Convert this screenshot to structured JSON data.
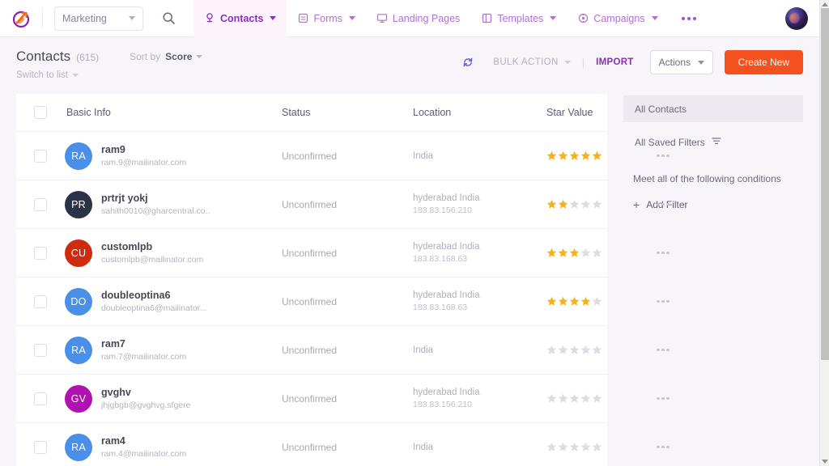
{
  "topnav": {
    "logo_name": "logo-icon",
    "workspace": {
      "label": "Marketing",
      "icon": "chevron-down-icon"
    },
    "search_icon": "search-icon",
    "items": [
      {
        "label": "Contacts",
        "icon": "person-icon",
        "active": true,
        "has_chevron": true
      },
      {
        "label": "Forms",
        "icon": "form-icon",
        "active": false,
        "has_chevron": true
      },
      {
        "label": "Landing Pages",
        "icon": "monitor-icon",
        "active": false,
        "has_chevron": false
      },
      {
        "label": "Templates",
        "icon": "template-icon",
        "active": false,
        "has_chevron": true
      },
      {
        "label": "Campaigns",
        "icon": "target-icon",
        "active": false,
        "has_chevron": true
      }
    ],
    "overflow_icon": "more-horizontal-icon",
    "avatar_name": "user-avatar"
  },
  "header": {
    "title": "Contacts",
    "count": "(615)",
    "switch_to_list": "Switch to list",
    "sort_label": "Sort by",
    "sort_value": "Score",
    "refresh_icon": "refresh-icon",
    "bulk_action": "BULK ACTION",
    "divider": "|",
    "import": "IMPORT",
    "actions": "Actions",
    "create_new": "Create New",
    "create_color": "#f4511e",
    "import_color": "#8b2fb5"
  },
  "table": {
    "columns": [
      "Basic Info",
      "Status",
      "Location",
      "Star Value"
    ],
    "rows": [
      {
        "initials": "RA",
        "avatar_color": "#4a90e8",
        "name": "ram9",
        "email": "ram.9@mailinator.com",
        "status": "Unconfirmed",
        "city": "India",
        "ip": "",
        "stars": 5
      },
      {
        "initials": "PR",
        "avatar_color": "#2b3346",
        "name": "prtrjt yokj",
        "email": "sahith0010@gharcentral.co..",
        "status": "Unconfirmed",
        "city": "hyderabad India",
        "ip": "183.83.156.210",
        "stars": 2
      },
      {
        "initials": "CU",
        "avatar_color": "#d02b10",
        "name": "customlpb",
        "email": "customlpb@mailinator.com",
        "status": "Unconfirmed",
        "city": "hyderabad India",
        "ip": "183.83.168.63",
        "stars": 3
      },
      {
        "initials": "DO",
        "avatar_color": "#4a90e8",
        "name": "doubleoptina6",
        "email": "doubleoptina6@mailinator...",
        "status": "Unconfirmed",
        "city": "hyderabad India",
        "ip": "183.83.168.63",
        "stars": 4
      },
      {
        "initials": "RA",
        "avatar_color": "#4a90e8",
        "name": "ram7",
        "email": "ram.7@mailinator.com",
        "status": "Unconfirmed",
        "city": "India",
        "ip": "",
        "stars": 0
      },
      {
        "initials": "GV",
        "avatar_color": "#b011b0",
        "name": "gvghv",
        "email": "jhjgbgb@gvghvg.sfgere",
        "status": "Unconfirmed",
        "city": "hyderabad India",
        "ip": "183.83.156.210",
        "stars": 0
      },
      {
        "initials": "RA",
        "avatar_color": "#4a90e8",
        "name": "ram4",
        "email": "ram.4@mailinator.com",
        "status": "Unconfirmed",
        "city": "India",
        "ip": "",
        "stars": 0
      }
    ],
    "star_filled_color": "#f5b31a",
    "star_empty_color": "#dcdde2",
    "row_menu_icon": "more-horizontal-icon"
  },
  "filter_pane": {
    "all_contacts": "All Contacts",
    "all_saved_filters": "All Saved Filters",
    "filter_icon": "filter-icon",
    "conditions_text": "Meet all of the following conditions",
    "add_filter": "Add Filter",
    "plus_icon": "plus-icon"
  }
}
